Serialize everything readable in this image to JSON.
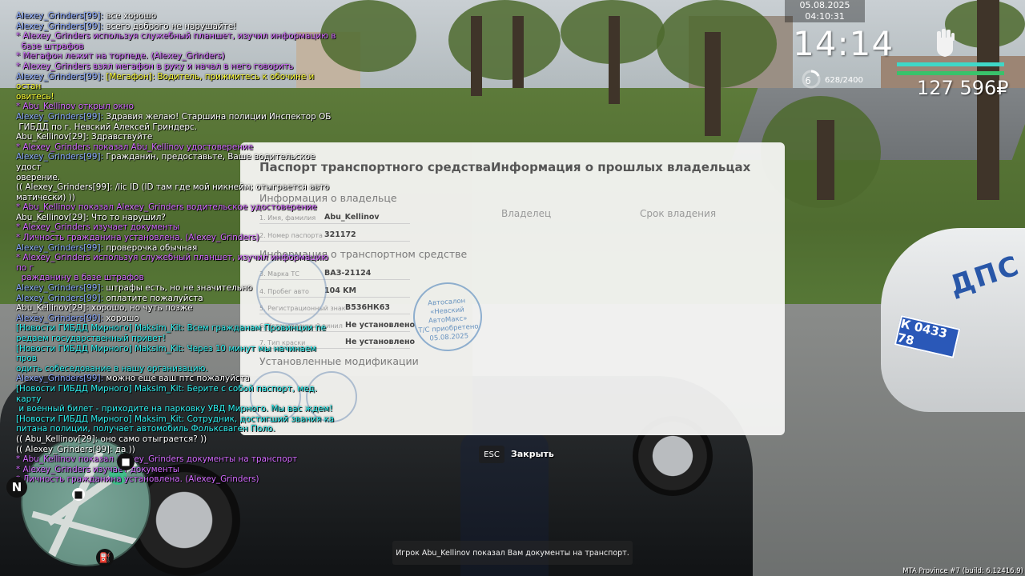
{
  "hud": {
    "datetime": "05.08.2025 04:10:31",
    "clock": "14:14",
    "level": "6",
    "xp": "628/2400",
    "money": "127 596₽"
  },
  "chat": [
    {
      "color": "white",
      "name": "Alexey_Grinders[99]:",
      "text": " все хорошо"
    },
    {
      "color": "white",
      "name": "Alexey_Grinders[99]:",
      "text": " всего доброго не нарушайте!"
    },
    {
      "color": "purple",
      "text": "* Alexey_Grinders используя служебный планшет, изучил информацию в"
    },
    {
      "color": "purple",
      "text": "  базе штрафов"
    },
    {
      "color": "purple",
      "text": "* Мегафон лежит на торпеде. (Alexey_Grinders)"
    },
    {
      "color": "purple",
      "text": "* Alexey_Grinders взял мегафон в руку и начал в него говорить"
    },
    {
      "color": "yellow",
      "name": "Alexey_Grinders[99]:",
      "text": " [Мегафон]: Водитель, прижмитесь к обочине и остан"
    },
    {
      "color": "yellow",
      "text": "овитесь!"
    },
    {
      "color": "purple",
      "text": "* Abu_Kellinov открыл окно"
    },
    {
      "color": "white",
      "name": "Alexey_Grinders[99]:",
      "text": " Здравия желаю! Старшина полиции Инспектор ОБ"
    },
    {
      "color": "white",
      "text": " ГИБДД по г. Невский Алексей Гриндерс."
    },
    {
      "color": "white",
      "text": "Abu_Kellinov[29]: Здравствуйте"
    },
    {
      "color": "purple",
      "text": "* Alexey_Grinders показал Abu_Kellinov удостоверение"
    },
    {
      "color": "white",
      "name": "Alexey_Grinders[99]:",
      "text": " Гражданин, предоставьте, Ваше водительское удост"
    },
    {
      "color": "white",
      "text": "оверение."
    },
    {
      "color": "white",
      "text": "(( Alexey_Grinders[99]: /lic ID (ID там где мой никнейм; отыграется авто"
    },
    {
      "color": "white",
      "text": "матически) ))"
    },
    {
      "color": "purple",
      "text": "* Abu_Kellinov показал Alexey_Grinders водительское удостоверение"
    },
    {
      "color": "white",
      "text": "Abu_Kellinov[29]: Что то нарушил?"
    },
    {
      "color": "purple",
      "text": "* Alexey_Grinders изучает документы"
    },
    {
      "color": "purple",
      "text": "* Личность гражданина установлена. (Alexey_Grinders)"
    },
    {
      "color": "white",
      "name": "Alexey_Grinders[99]:",
      "text": " проверочка обычная"
    },
    {
      "color": "purple",
      "text": "* Alexey_Grinders используя служебный планшет, изучил информацию по г"
    },
    {
      "color": "purple",
      "text": "  ражданину в базе штрафов"
    },
    {
      "color": "white",
      "name": "Alexey_Grinders[99]:",
      "text": " штрафы есть, но не значительно"
    },
    {
      "color": "white",
      "name": "Alexey_Grinders[99]:",
      "text": " оплатите пожалуйста"
    },
    {
      "color": "white",
      "text": "Abu_Kellinov[29]: хорошо, но чуть позже"
    },
    {
      "color": "white",
      "name": "Alexey_Grinders[99]:",
      "text": " хорошо"
    },
    {
      "color": "cyan",
      "text": "[Новости ГИБДД Мирного] Maksim_Kit: Всем гражданам Провинции пе"
    },
    {
      "color": "cyan",
      "text": "редаем государственный привет!"
    },
    {
      "color": "cyan",
      "text": "[Новости ГИБДД Мирного] Maksim_Kit: Через 10 минут мы начинаем пров"
    },
    {
      "color": "cyan",
      "text": "одить собеседование в нашу организацию."
    },
    {
      "color": "white",
      "name": "Alexey_Grinders[99]:",
      "text": " можно еще ваш птс пожалуйста"
    },
    {
      "color": "cyan",
      "text": "[Новости ГИБДД Мирного] Maksim_Kit: Берите с собой паспорт, мед. карту"
    },
    {
      "color": "cyan",
      "text": " и военный билет - приходите на парковку УВД Мирного. Мы вас ждем!"
    },
    {
      "color": "cyan",
      "text": "[Новости ГИБДД Мирного] Maksim_Kit: Сотрудник, достигший звания ка"
    },
    {
      "color": "cyan",
      "text": "питана полиции, получает автомобиль Фольксваген Поло."
    },
    {
      "color": "white",
      "text": "(( Abu_Kellinov[29]: оно само отыграется? ))"
    },
    {
      "color": "white",
      "text": "(( Alexey_Grinders[99]: да ))"
    },
    {
      "color": "purple",
      "text": "* Abu_Kellinov показал Alexey_Grinders документы на транспорт"
    },
    {
      "color": "purple",
      "text": "* Alexey_Grinders изучает документы"
    },
    {
      "color": "purple",
      "text": "* Личность гражданина установлена. (Alexey_Grinders)"
    }
  ],
  "document": {
    "title_left": "Паспорт транспортного средства",
    "title_right": "Информация о прошлых владельцах",
    "owner_section": "Информация о владельце",
    "vehicle_section": "Информация о транспортном средстве",
    "mods_section": "Установленные модификации",
    "owner_rows": [
      {
        "label": "1. Имя, фамилия",
        "value": "Abu_Kellinov"
      },
      {
        "label": "2. Номер паспорта",
        "value": "321172"
      }
    ],
    "vehicle_rows": [
      {
        "label": "3. Марка ТС",
        "value": "ВАЗ-21124"
      },
      {
        "label": "4. Пробег авто",
        "value": "104 KM"
      },
      {
        "label": "5. Регистрационный знак",
        "value": "В536НК63"
      },
      {
        "label": "6. Установленный винил",
        "value": "Не установлено"
      },
      {
        "label": "7. Тип краски",
        "value": "Не установлено"
      }
    ],
    "col_owner": "Владелец",
    "col_term": "Срок владения",
    "stamp_lines": [
      "Автосалон",
      "«Невский АвтоМакс»",
      "Т/С приобретено",
      "05.08.2025"
    ]
  },
  "controls": {
    "esc_key": "ESC",
    "close_label": "Закрыть"
  },
  "minimap": {
    "north_label": "N"
  },
  "police_car": {
    "text": "ДПС",
    "plate": "К 0433 78"
  },
  "notification": "Игрок Abu_Kellinov показал Вам документы на транспорт.",
  "build_info": "MTA Province #7 (build: 6.12416.9)"
}
